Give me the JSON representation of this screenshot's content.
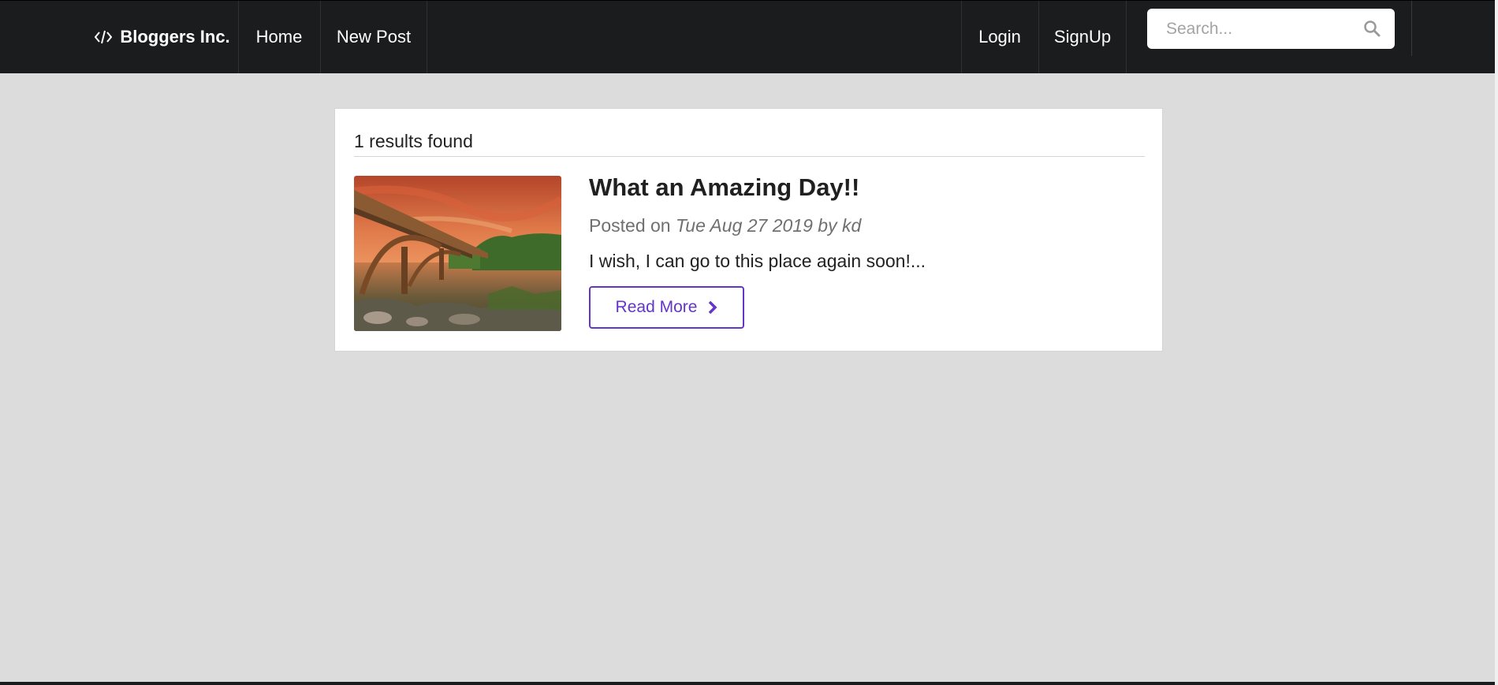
{
  "navbar": {
    "brand_label": "Bloggers Inc.",
    "home_label": "Home",
    "new_post_label": "New Post",
    "login_label": "Login",
    "signup_label": "SignUp",
    "search_placeholder": "Search...",
    "search_value": ""
  },
  "results": {
    "summary": "1 results found"
  },
  "post": {
    "title": "What an Amazing Day!!",
    "meta_prefix": "Posted on ",
    "meta_date_author": "Tue Aug 27 2019 by kd",
    "excerpt": "I wish, I can go to this place again soon!...",
    "read_more_label": "Read More"
  },
  "colors": {
    "navbar_bg": "#1b1c1d",
    "page_bg": "#dcdcdc",
    "accent": "#6435c9"
  },
  "icons": {
    "brand": "code-icon",
    "search": "search-icon",
    "read_more": "chevron-right-icon"
  }
}
